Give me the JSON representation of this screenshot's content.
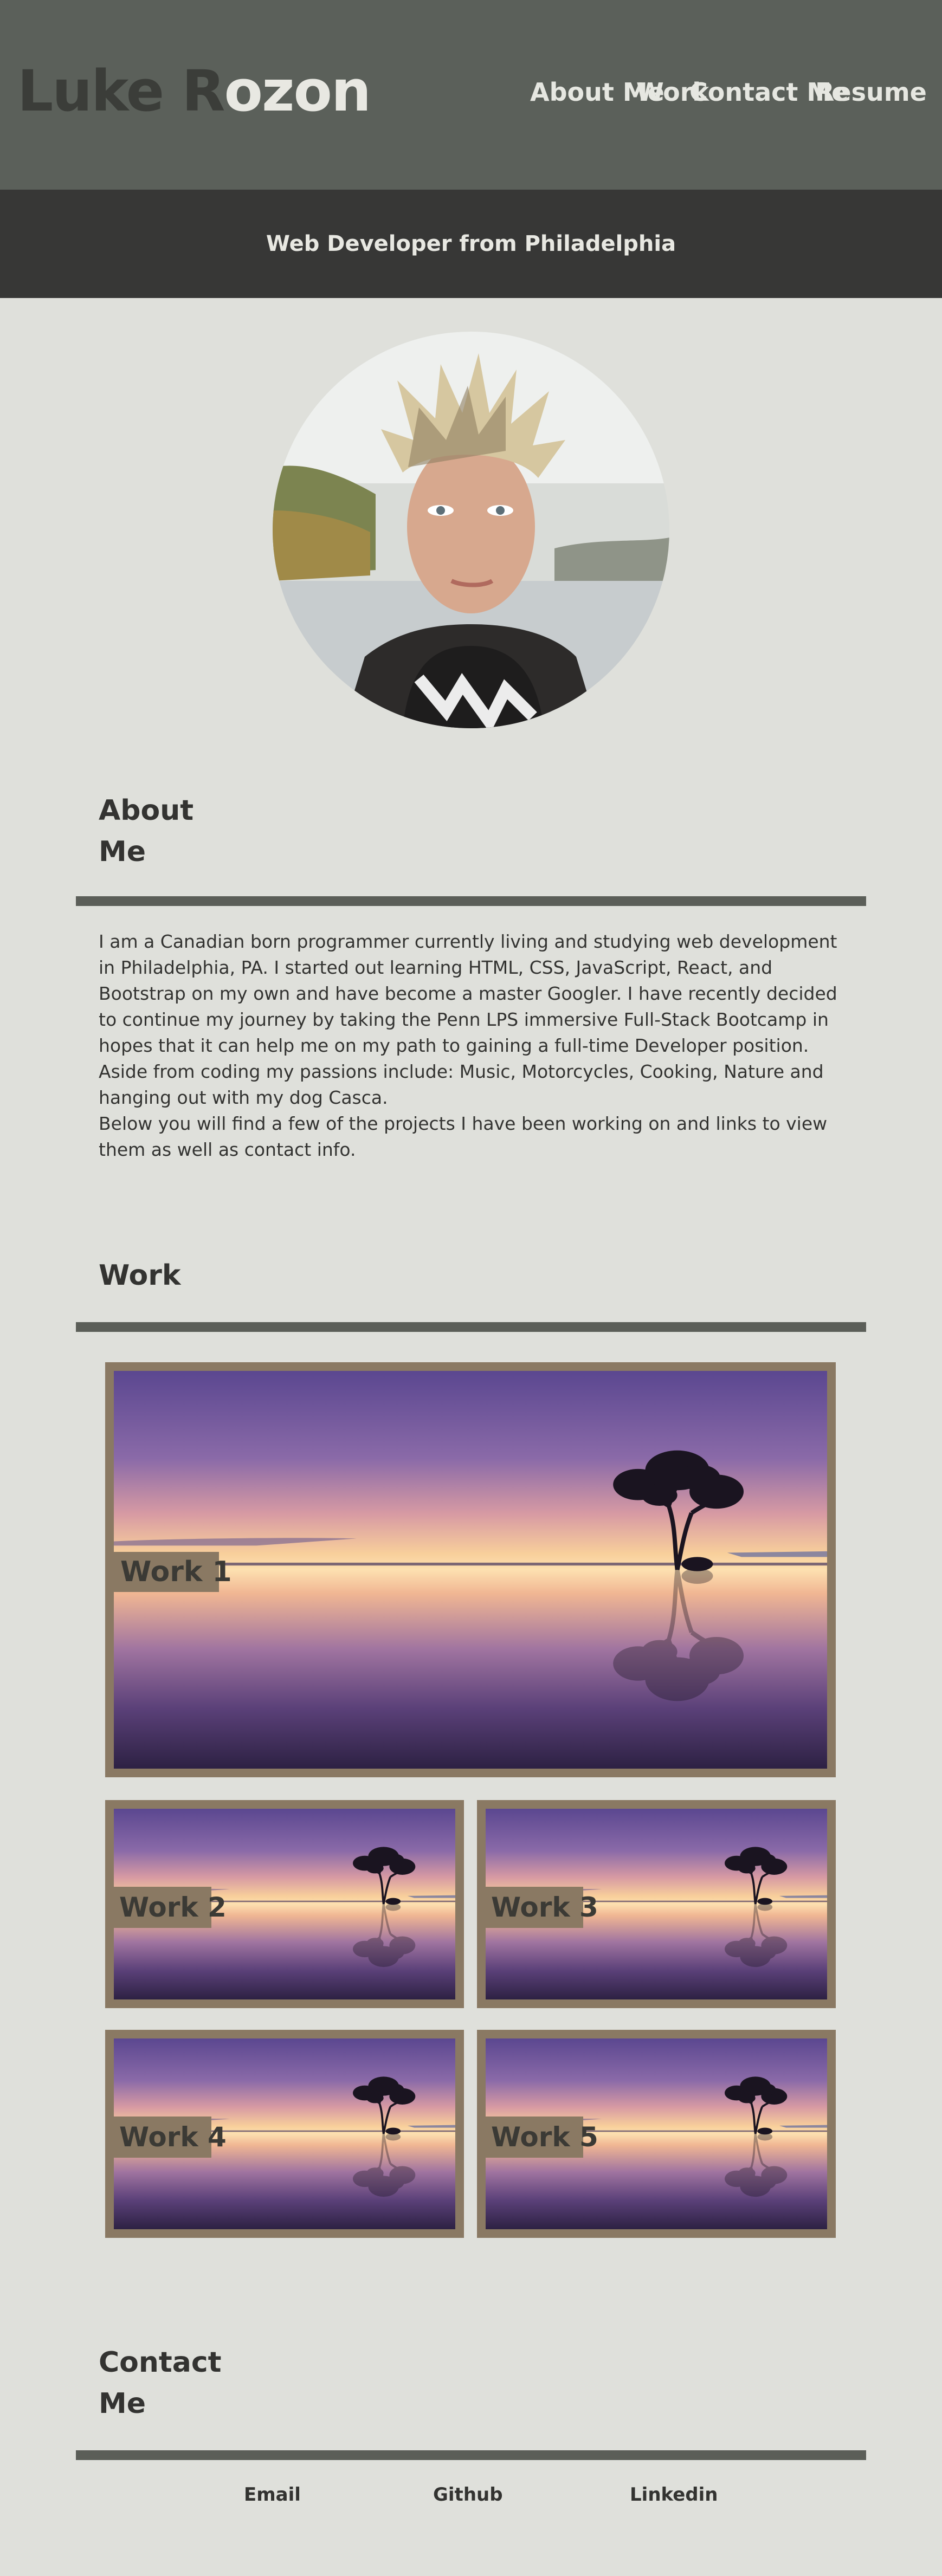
{
  "header": {
    "logo_dark": "Luke R",
    "logo_light": "ozon",
    "nav": [
      "About Me",
      "Work",
      "Contact Me",
      "Resume"
    ]
  },
  "subtitle": "Web Developer from Philadelphia",
  "about": {
    "title_line1": "About",
    "title_line2": "Me",
    "paragraph1": "I am a Canadian born programmer currently living and studying web development in Philadelphia, PA. I started out learning HTML, CSS, JavaScript, React, and Bootstrap on my own and have become a master Googler. I have recently decided to continue my journey by taking the Penn LPS immersive Full-Stack Bootcamp in hopes that it can help me on my path to gaining a full-time Developer position. Aside from coding my passions include: Music, Motorcycles, Cooking, Nature and hanging out with my dog Casca.",
    "paragraph2": "Below you will find a few of the projects I have been working on and links to view them as well as contact info."
  },
  "work": {
    "title": "Work",
    "items": [
      "Work 1",
      "Work 2",
      "Work 3",
      "Work 4",
      "Work 5"
    ]
  },
  "contact": {
    "title_line1": "Contact",
    "title_line2": "Me",
    "links": [
      "Email",
      "Github",
      "Linkedin"
    ]
  },
  "colors": {
    "header_bg": "#5b605a",
    "subbar_bg": "#373736",
    "page_bg": "#dfe0db",
    "card_frame": "#8a7963",
    "rule": "#5b5e58"
  }
}
